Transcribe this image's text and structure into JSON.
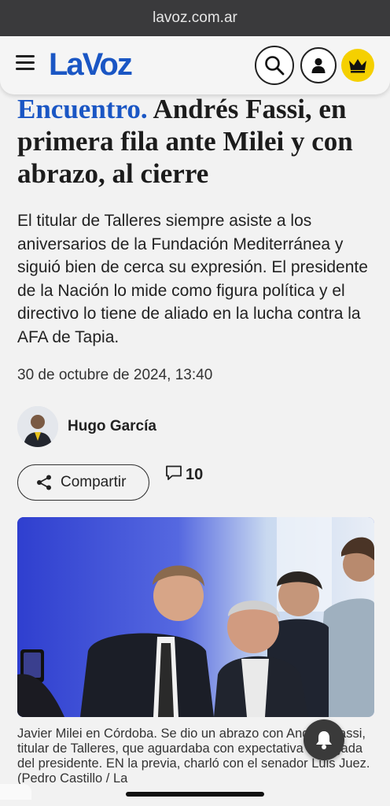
{
  "browser": {
    "url": "lavoz.com.ar"
  },
  "header": {
    "logo": "LaVoz",
    "icons": {
      "menu": "menu-icon",
      "search": "search-icon",
      "user": "user-icon",
      "premium": "crown-icon"
    },
    "premium_color": "#f5d000",
    "brand_color": "#1a56c4"
  },
  "article": {
    "kicker": "Encuentro.",
    "title": " Andrés Fassi, en primera fila ante Milei y con abrazo, al cierre",
    "summary": "El titular de Talleres siempre asiste a los aniversarios de la Fundación Mediterránea y siguió bien de cerca su expresión. El presidente de la Nación lo mide como figura política y el directivo lo tiene de aliado en la lucha contra la AFA de Tapia.",
    "date": "30 de octubre de 2024, 13:40",
    "author": "Hugo García",
    "share_label": "Compartir",
    "comment_count": "10",
    "caption": "Javier Milei en Córdoba. Se dio un abrazo con Andrés Fassi, titular de Talleres, que aguardaba con expectativa la llegada del presidente. EN la previa, charló con el senador Luis Juez. (Pedro Castillo / La"
  }
}
